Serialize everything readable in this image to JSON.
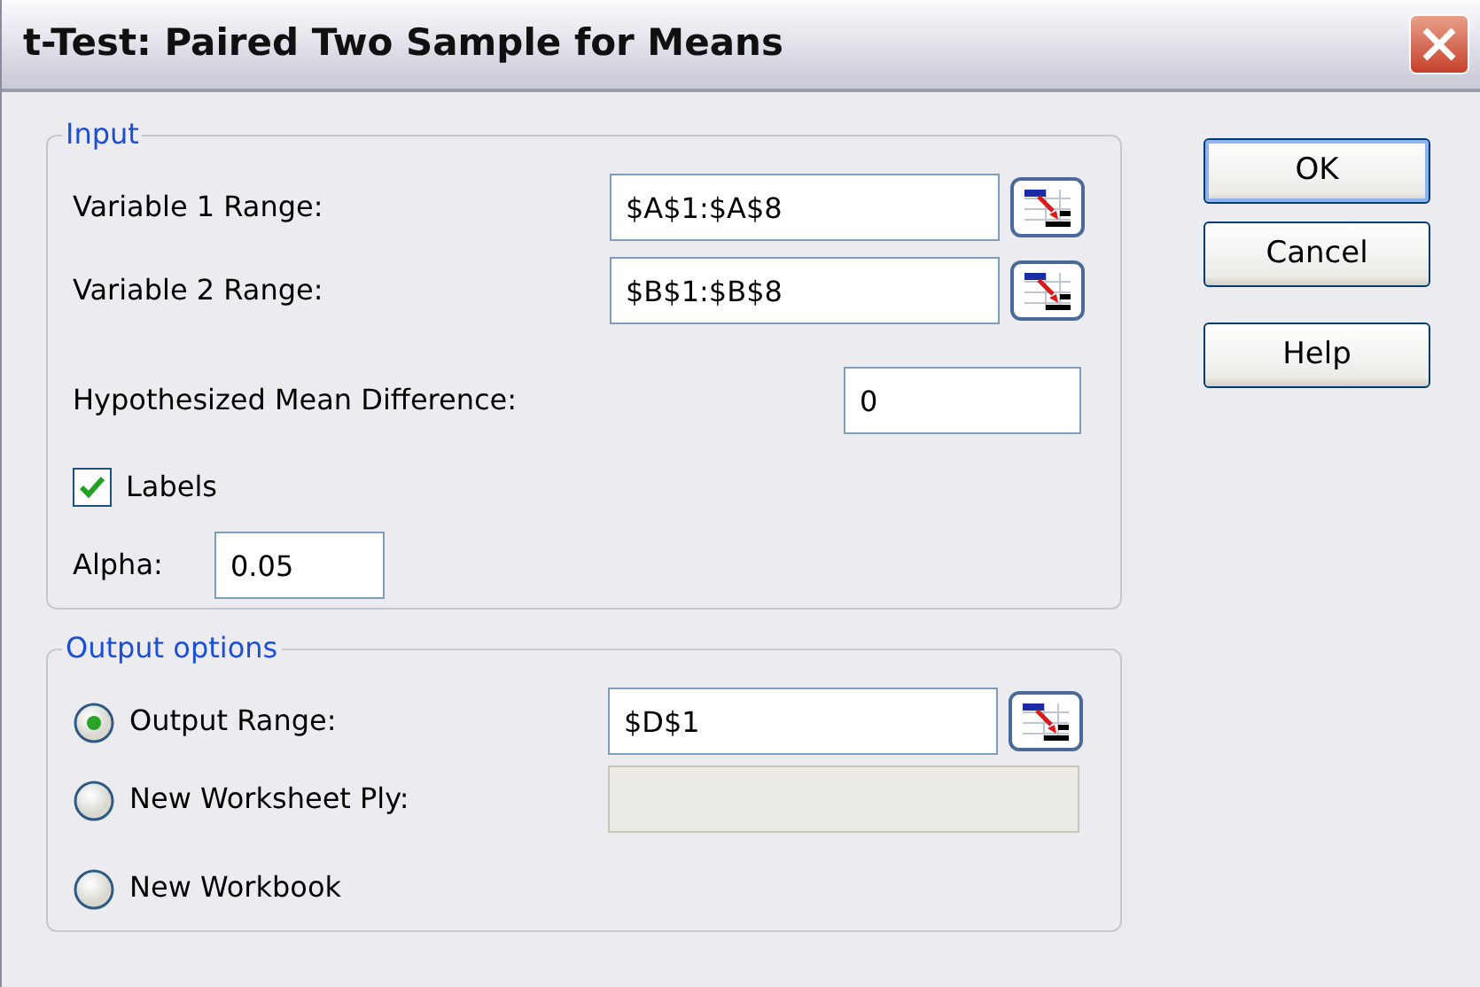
{
  "window": {
    "title": "t-Test: Paired Two Sample for Means"
  },
  "input": {
    "legend": "Input",
    "ranges": [
      {
        "label": "Variable 1 Range:",
        "value": "$A$1:$A$8"
      },
      {
        "label": "Variable 2 Range:",
        "value": "$B$1:$B$8"
      }
    ],
    "hypothesized": {
      "label": "Hypothesized Mean Difference:",
      "value": "0"
    },
    "labels": {
      "label": "Labels",
      "checked": true
    },
    "alpha": {
      "label": "Alpha:",
      "value": "0.05"
    }
  },
  "output": {
    "legend": "Output options",
    "options": [
      {
        "label": "Output Range:",
        "selected": true,
        "field": {
          "value": "$D$1",
          "disabled": false,
          "picker": true
        }
      },
      {
        "label": "New Worksheet Ply:",
        "selected": false,
        "field": {
          "disabled": true,
          "picker": false
        }
      },
      {
        "label": "New Workbook",
        "selected": false
      }
    ]
  },
  "buttons": [
    {
      "label": "OK",
      "default": true
    },
    {
      "label": "Cancel",
      "default": false
    },
    {
      "label": "Help",
      "default": false
    }
  ]
}
